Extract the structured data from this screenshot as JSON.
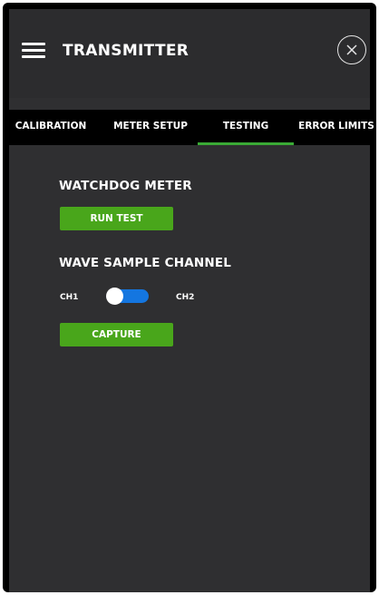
{
  "header": {
    "title": "TRANSMITTER",
    "menu_icon": "hamburger-menu-icon",
    "close_icon": "close-icon"
  },
  "tabs": [
    {
      "label": "CALIBRATION",
      "active": false
    },
    {
      "label": "METER SETUP",
      "active": false
    },
    {
      "label": "TESTING",
      "active": true
    },
    {
      "label": "ERROR LIMITS",
      "active": false
    }
  ],
  "testing": {
    "watchdog": {
      "label": "WATCHDOG METER",
      "button_label": "RUN TEST"
    },
    "wave_sample": {
      "label": "WAVE SAMPLE CHANNEL",
      "left_option": "CH1",
      "right_option": "CH2",
      "capture_label": "CAPTURE"
    }
  },
  "colors": {
    "accent_green": "#49a61b",
    "tab_underline": "#3aaa35",
    "toggle_blue": "#1476e0",
    "background": "#2f2f31"
  }
}
